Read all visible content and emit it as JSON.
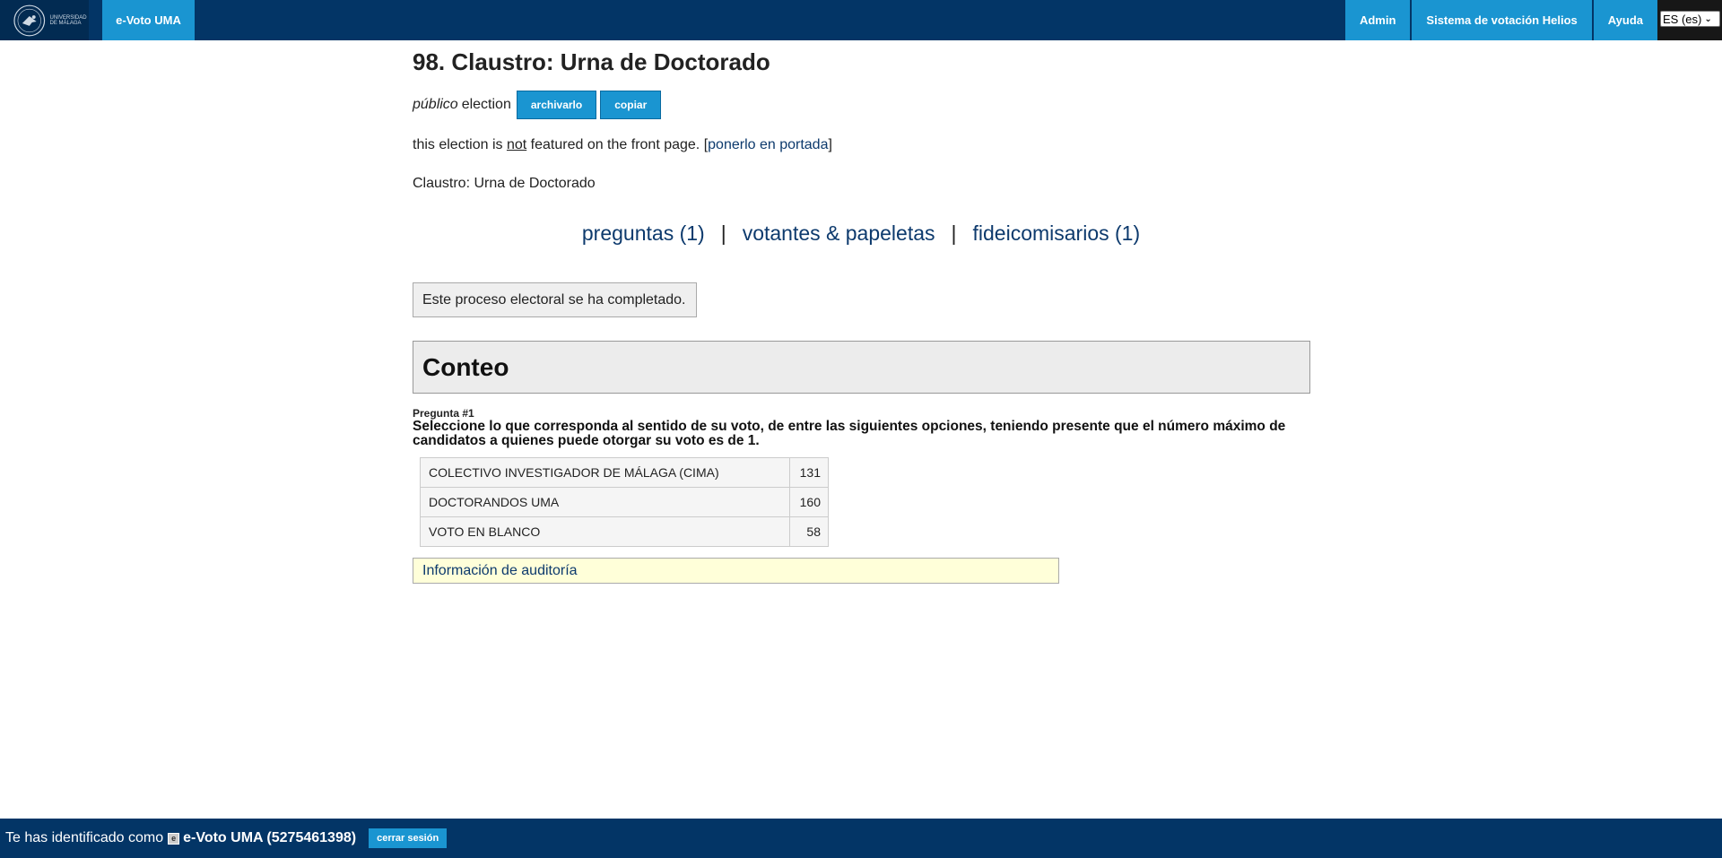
{
  "header": {
    "logo_text": "UNIVERSIDAD DE MÁLAGA",
    "brand": "e-Voto UMA",
    "nav": [
      "Admin",
      "Sistema de votación Helios",
      "Ayuda"
    ],
    "language": "ES (es)"
  },
  "election": {
    "title": "98. Claustro: Urna de Doctorado",
    "kind": "público",
    "kind_suffix": "election",
    "archive_button": "archivarlo",
    "copy_button": "copiar",
    "featured_prefix": "this election is",
    "featured_not": "not",
    "featured_suffix": "featured on the front page. [",
    "featured_link": "ponerlo en portada",
    "featured_close": "]",
    "description": "Claustro: Urna de Doctorado"
  },
  "tabs": {
    "questions": "preguntas (1)",
    "voters": "votantes & papeletas",
    "trustees": "fideicomisarios (1)",
    "separator": "|"
  },
  "notice": "Este proceso electoral se ha completado.",
  "tally": {
    "heading": "Conteo",
    "question_number": "Pregunta #1",
    "question_text": "Seleccione lo que corresponda al sentido de su voto, de entre las siguientes opciones, teniendo presente que el número máximo de candidatos a quienes puede otorgar su voto es de 1.",
    "results": [
      {
        "name": "COLECTIVO INVESTIGADOR DE MÁLAGA (CIMA)",
        "count": "131"
      },
      {
        "name": "DOCTORANDOS UMA",
        "count": "160"
      },
      {
        "name": "VOTO EN BLANCO",
        "count": "58"
      }
    ],
    "audit_link": "Información de auditoría"
  },
  "footer": {
    "logged_in_as": "Te has identificado como",
    "user": "e-Voto UMA (5275461398)",
    "user_icon_glyph": "e",
    "logout": "cerrar sesión"
  },
  "colors": {
    "navy": "#033566",
    "accent": "#1a95d1",
    "link": "#0d3a6d"
  }
}
